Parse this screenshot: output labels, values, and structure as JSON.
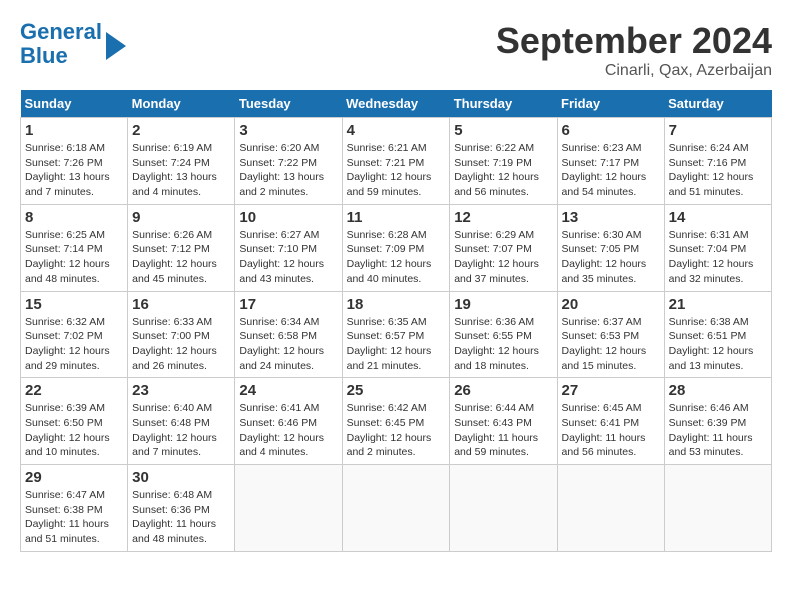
{
  "header": {
    "logo_line1": "General",
    "logo_line2": "Blue",
    "month_title": "September 2024",
    "location": "Cinarli, Qax, Azerbaijan"
  },
  "weekdays": [
    "Sunday",
    "Monday",
    "Tuesday",
    "Wednesday",
    "Thursday",
    "Friday",
    "Saturday"
  ],
  "weeks": [
    [
      {
        "day": "1",
        "info": "Sunrise: 6:18 AM\nSunset: 7:26 PM\nDaylight: 13 hours\nand 7 minutes."
      },
      {
        "day": "2",
        "info": "Sunrise: 6:19 AM\nSunset: 7:24 PM\nDaylight: 13 hours\nand 4 minutes."
      },
      {
        "day": "3",
        "info": "Sunrise: 6:20 AM\nSunset: 7:22 PM\nDaylight: 13 hours\nand 2 minutes."
      },
      {
        "day": "4",
        "info": "Sunrise: 6:21 AM\nSunset: 7:21 PM\nDaylight: 12 hours\nand 59 minutes."
      },
      {
        "day": "5",
        "info": "Sunrise: 6:22 AM\nSunset: 7:19 PM\nDaylight: 12 hours\nand 56 minutes."
      },
      {
        "day": "6",
        "info": "Sunrise: 6:23 AM\nSunset: 7:17 PM\nDaylight: 12 hours\nand 54 minutes."
      },
      {
        "day": "7",
        "info": "Sunrise: 6:24 AM\nSunset: 7:16 PM\nDaylight: 12 hours\nand 51 minutes."
      }
    ],
    [
      {
        "day": "8",
        "info": "Sunrise: 6:25 AM\nSunset: 7:14 PM\nDaylight: 12 hours\nand 48 minutes."
      },
      {
        "day": "9",
        "info": "Sunrise: 6:26 AM\nSunset: 7:12 PM\nDaylight: 12 hours\nand 45 minutes."
      },
      {
        "day": "10",
        "info": "Sunrise: 6:27 AM\nSunset: 7:10 PM\nDaylight: 12 hours\nand 43 minutes."
      },
      {
        "day": "11",
        "info": "Sunrise: 6:28 AM\nSunset: 7:09 PM\nDaylight: 12 hours\nand 40 minutes."
      },
      {
        "day": "12",
        "info": "Sunrise: 6:29 AM\nSunset: 7:07 PM\nDaylight: 12 hours\nand 37 minutes."
      },
      {
        "day": "13",
        "info": "Sunrise: 6:30 AM\nSunset: 7:05 PM\nDaylight: 12 hours\nand 35 minutes."
      },
      {
        "day": "14",
        "info": "Sunrise: 6:31 AM\nSunset: 7:04 PM\nDaylight: 12 hours\nand 32 minutes."
      }
    ],
    [
      {
        "day": "15",
        "info": "Sunrise: 6:32 AM\nSunset: 7:02 PM\nDaylight: 12 hours\nand 29 minutes."
      },
      {
        "day": "16",
        "info": "Sunrise: 6:33 AM\nSunset: 7:00 PM\nDaylight: 12 hours\nand 26 minutes."
      },
      {
        "day": "17",
        "info": "Sunrise: 6:34 AM\nSunset: 6:58 PM\nDaylight: 12 hours\nand 24 minutes."
      },
      {
        "day": "18",
        "info": "Sunrise: 6:35 AM\nSunset: 6:57 PM\nDaylight: 12 hours\nand 21 minutes."
      },
      {
        "day": "19",
        "info": "Sunrise: 6:36 AM\nSunset: 6:55 PM\nDaylight: 12 hours\nand 18 minutes."
      },
      {
        "day": "20",
        "info": "Sunrise: 6:37 AM\nSunset: 6:53 PM\nDaylight: 12 hours\nand 15 minutes."
      },
      {
        "day": "21",
        "info": "Sunrise: 6:38 AM\nSunset: 6:51 PM\nDaylight: 12 hours\nand 13 minutes."
      }
    ],
    [
      {
        "day": "22",
        "info": "Sunrise: 6:39 AM\nSunset: 6:50 PM\nDaylight: 12 hours\nand 10 minutes."
      },
      {
        "day": "23",
        "info": "Sunrise: 6:40 AM\nSunset: 6:48 PM\nDaylight: 12 hours\nand 7 minutes."
      },
      {
        "day": "24",
        "info": "Sunrise: 6:41 AM\nSunset: 6:46 PM\nDaylight: 12 hours\nand 4 minutes."
      },
      {
        "day": "25",
        "info": "Sunrise: 6:42 AM\nSunset: 6:45 PM\nDaylight: 12 hours\nand 2 minutes."
      },
      {
        "day": "26",
        "info": "Sunrise: 6:44 AM\nSunset: 6:43 PM\nDaylight: 11 hours\nand 59 minutes."
      },
      {
        "day": "27",
        "info": "Sunrise: 6:45 AM\nSunset: 6:41 PM\nDaylight: 11 hours\nand 56 minutes."
      },
      {
        "day": "28",
        "info": "Sunrise: 6:46 AM\nSunset: 6:39 PM\nDaylight: 11 hours\nand 53 minutes."
      }
    ],
    [
      {
        "day": "29",
        "info": "Sunrise: 6:47 AM\nSunset: 6:38 PM\nDaylight: 11 hours\nand 51 minutes."
      },
      {
        "day": "30",
        "info": "Sunrise: 6:48 AM\nSunset: 6:36 PM\nDaylight: 11 hours\nand 48 minutes."
      },
      {
        "day": "",
        "info": ""
      },
      {
        "day": "",
        "info": ""
      },
      {
        "day": "",
        "info": ""
      },
      {
        "day": "",
        "info": ""
      },
      {
        "day": "",
        "info": ""
      }
    ]
  ]
}
